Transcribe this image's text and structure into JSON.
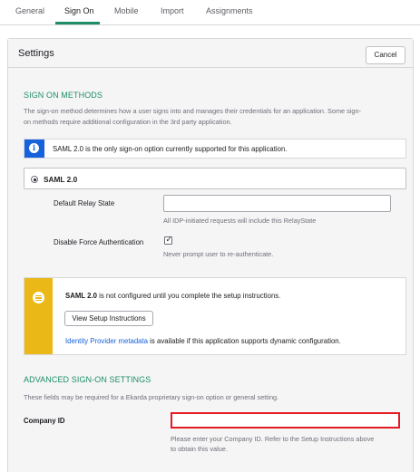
{
  "tabs": [
    {
      "label": "General"
    },
    {
      "label": "Sign On"
    },
    {
      "label": "Mobile"
    },
    {
      "label": "Import"
    },
    {
      "label": "Assignments"
    }
  ],
  "active_tab": "Sign On",
  "settings": {
    "title": "Settings",
    "cancel_label": "Cancel"
  },
  "sign_on_methods": {
    "title": "SIGN ON METHODS",
    "description_line1": "The sign-on method determines how a user signs into and manages their credentials for an application. Some sign-",
    "description_line2": "on methods require additional configuration in the 3rd party application."
  },
  "info_banner": {
    "text": "SAML 2.0 is the only sign-on option currently supported for this application.",
    "icon": "info-icon",
    "color": "#1662dd"
  },
  "saml": {
    "label": "SAML 2.0",
    "selected": true,
    "relay_state": {
      "label": "Default Relay State",
      "value": "",
      "hint": "All IDP-initiated requests will include this RelayState"
    },
    "force_auth": {
      "label": "Disable Force Authentication",
      "checked": true,
      "hint": "Never prompt user to re-authenticate."
    }
  },
  "setup_notice": {
    "icon": "setup-list-icon",
    "color": "#eab917",
    "bold_text": "SAML 2.0",
    "text_rest": " is not configured until you complete the setup instructions.",
    "button_label": "View Setup Instructions",
    "link_text": "Identity Provider metadata",
    "link_rest": " is available if this application supports dynamic configuration."
  },
  "advanced": {
    "title": "ADVANCED SIGN-ON SETTINGS",
    "description": "These fields may be required for a Ekarda proprietary sign-on option or general setting.",
    "company_id": {
      "label": "Company ID",
      "value": "",
      "hint_line1": "Please enter your Company ID. Refer to the Setup Instructions above",
      "hint_line2": "to obtain this value.",
      "highlight_color": "#e31b23"
    }
  },
  "colors": {
    "accent": "#1d8e66",
    "link": "#1662dd"
  }
}
